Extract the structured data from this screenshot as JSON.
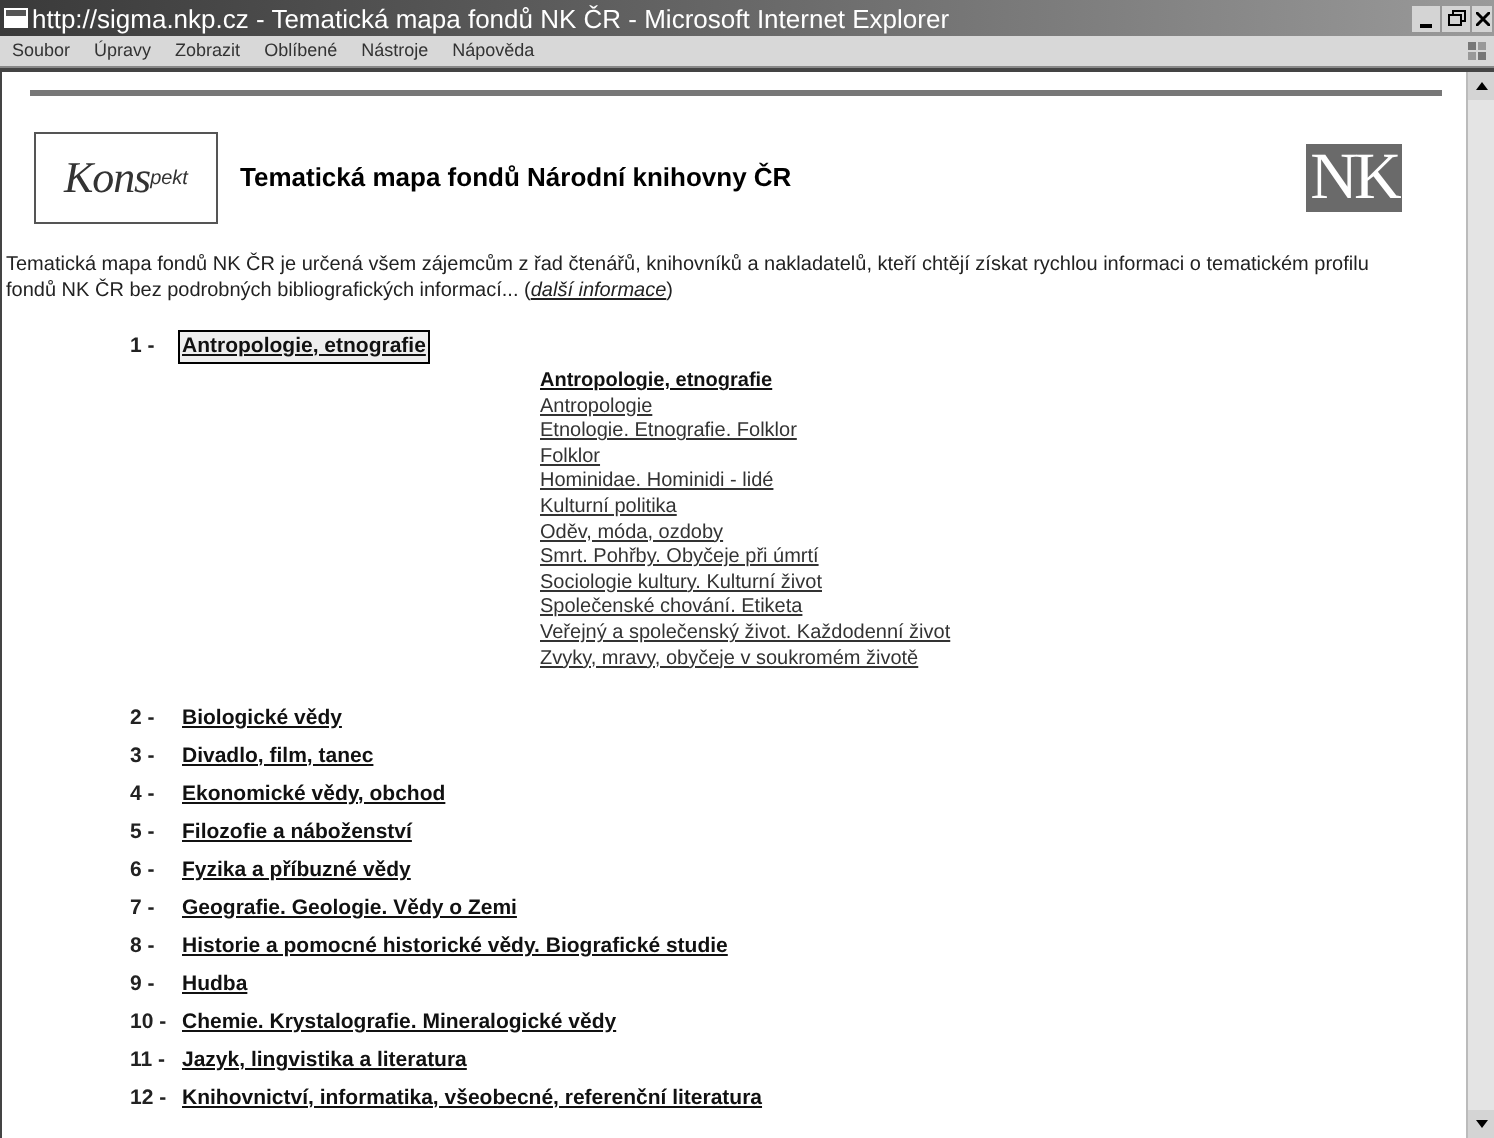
{
  "window": {
    "title": "http://sigma.nkp.cz - Tematická mapa fondů NK ČR - Microsoft Internet Explorer"
  },
  "menu": [
    "Soubor",
    "Úpravy",
    "Zobrazit",
    "Oblíbené",
    "Nástroje",
    "Nápověda"
  ],
  "header": {
    "logo": {
      "main": "Kons",
      "suffix": "pekt"
    },
    "title": "Tematická mapa fondů Národní knihovny ČR",
    "nk_logo": "NK"
  },
  "intro": {
    "text": "Tematická mapa fondů NK ČR je určená všem zájemcům z řad čtenářů, knihovníků a nakladatelů, kteří chtějí získat rychlou informaci o tematickém profilu fondů NK ČR bez podrobných bibliografických informací...  (",
    "link": "další informace",
    "after": ")"
  },
  "categories": [
    {
      "number": "1 -",
      "label": "Antropologie, etnografie",
      "selected": true,
      "heading": "Antropologie, etnografie",
      "children": [
        "Antropologie",
        "Etnologie. Etnografie. Folklor",
        "Folklor",
        "Hominidae. Hominidi - lidé",
        "Kulturní politika",
        "Oděv, móda, ozdoby",
        "Smrt. Pohřby. Obyčeje při úmrtí",
        "Sociologie kultury. Kulturní život",
        "Společenské chování. Etiketa",
        "Veřejný a společenský život. Každodenní život",
        "Zvyky, mravy, obyčeje v soukromém životě"
      ]
    },
    {
      "number": "2 -",
      "label": "Biologické vědy",
      "selected": false
    },
    {
      "number": "3 -",
      "label": "Divadlo, film, tanec",
      "selected": false
    },
    {
      "number": "4 -",
      "label": "Ekonomické vědy, obchod",
      "selected": false
    },
    {
      "number": "5 -",
      "label": "Filozofie a náboženství",
      "selected": false
    },
    {
      "number": "6 -",
      "label": "Fyzika a příbuzné vědy",
      "selected": false
    },
    {
      "number": "7 -",
      "label": "Geografie. Geologie. Vědy o Zemi",
      "selected": false
    },
    {
      "number": "8 -",
      "label": "Historie a pomocné historické vědy. Biografické studie",
      "selected": false
    },
    {
      "number": "9 -",
      "label": "Hudba",
      "selected": false
    },
    {
      "number": "10 -",
      "label": "Chemie. Krystalografie. Mineralogické vědy",
      "selected": false
    },
    {
      "number": "11 -",
      "label": "Jazyk, lingvistika a literatura",
      "selected": false
    },
    {
      "number": "12 -",
      "label": "Knihovnictví, informatika, všeobecné, referenční literatura",
      "selected": false
    }
  ]
}
